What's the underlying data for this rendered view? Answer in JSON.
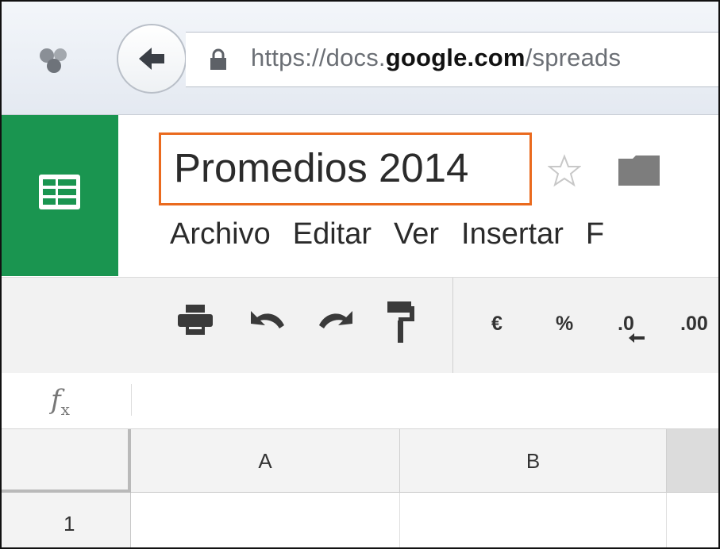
{
  "browser": {
    "url_prefix": "https://docs.",
    "url_domain": "google.com",
    "url_path": "/spreads"
  },
  "doc": {
    "title": "Promedios 2014"
  },
  "menu": {
    "items": [
      "Archivo",
      "Editar",
      "Ver",
      "Insertar",
      "F"
    ]
  },
  "toolbar": {
    "currency_label": "€",
    "percent_label": "%",
    "decrease_decimals_label": ".0",
    "increase_decimals_label": ".00"
  },
  "formula_bar": {
    "fx_label": "f",
    "fx_sub": "x"
  },
  "grid": {
    "columns": [
      "A",
      "B"
    ],
    "rows": [
      "1"
    ]
  },
  "colors": {
    "sheets_green": "#1a9550",
    "highlight_orange": "#ea6a1e"
  }
}
